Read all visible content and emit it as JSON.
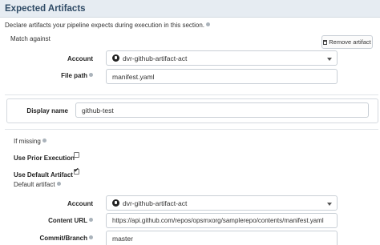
{
  "section": {
    "title": "Expected Artifacts",
    "description": "Declare artifacts your pipeline expects during execution in this section."
  },
  "match": {
    "label": "Match against",
    "remove_button": "Remove artifact",
    "account_label": "Account",
    "account_value": "dvr-github-artifact-act",
    "filepath_label": "File path",
    "filepath_value": "manifest.yaml"
  },
  "display": {
    "label": "Display name",
    "value": "github-test"
  },
  "missing": {
    "label": "If missing",
    "use_prior_label": "Use Prior Execution",
    "use_prior_checked": false,
    "use_default_label": "Use Default Artifact",
    "use_default_checked": true,
    "default_artifact_label": "Default artifact"
  },
  "default": {
    "account_label": "Account",
    "account_value": "dvr-github-artifact-act",
    "content_url_label": "Content URL",
    "content_url_value": "https://api.github.com/repos/opsmxorg/samplerepo/contents/manifest.yaml",
    "commit_label": "Commit/Branch",
    "commit_value": "master"
  }
}
